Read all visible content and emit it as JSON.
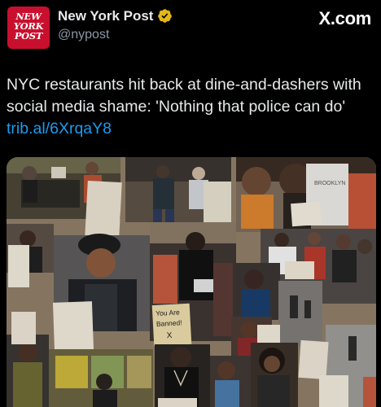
{
  "account": {
    "display_name": "New York Post",
    "handle": "@nypost",
    "avatar_lines": [
      "NEW",
      "YORK",
      "POST"
    ],
    "verified": true
  },
  "source": {
    "logo_text": "X.com"
  },
  "post": {
    "text": "NYC restaurants hit back at dine-and-dashers with social media shame: 'Nothing that police can do' ",
    "link_text": "trib.al/6XrqaY8"
  },
  "media": {
    "description_visible_text": {
      "sign_line_1": "You Are",
      "sign_line_2": "Banned!",
      "sign_line_3": "X",
      "shirt_text": "BROOKLYN"
    }
  },
  "colors": {
    "background": "#000000",
    "text": "#e7e9ea",
    "muted": "#8b98a5",
    "link": "#1d9bf0",
    "brand_red": "#c8102e",
    "verified_gold": "#e2b719"
  },
  "icons": {
    "verified": "verified-badge-icon"
  }
}
